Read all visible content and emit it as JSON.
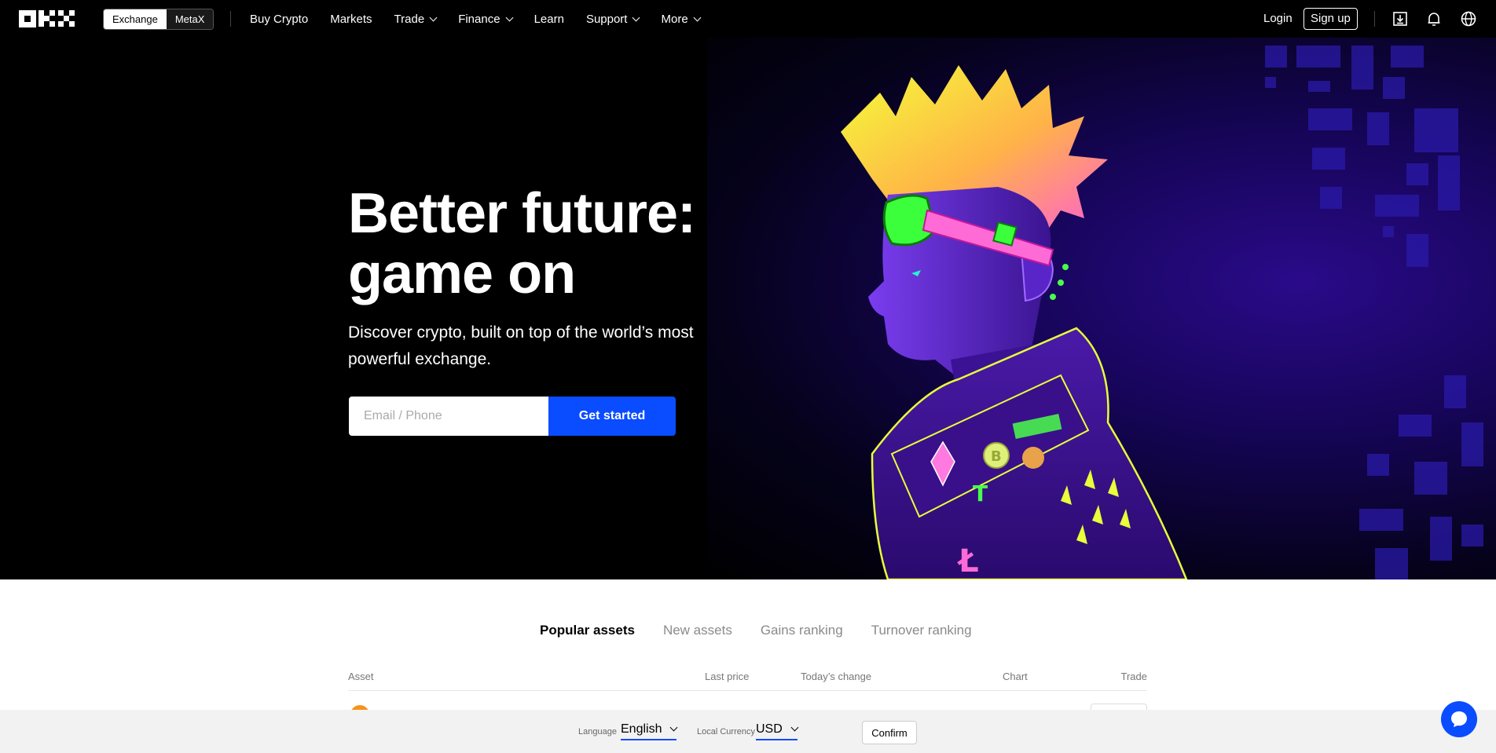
{
  "nav": {
    "switcher": [
      "Exchange",
      "MetaX"
    ],
    "links": [
      {
        "label": "Buy Crypto",
        "dropdown": false
      },
      {
        "label": "Markets",
        "dropdown": false
      },
      {
        "label": "Trade",
        "dropdown": true
      },
      {
        "label": "Finance",
        "dropdown": true
      },
      {
        "label": "Learn",
        "dropdown": false
      },
      {
        "label": "Support",
        "dropdown": true
      },
      {
        "label": "More",
        "dropdown": true
      }
    ],
    "login": "Login",
    "signup": "Sign up",
    "icons": [
      "download-icon",
      "bell-icon",
      "globe-icon"
    ]
  },
  "hero": {
    "headline_line1": "Better future:",
    "headline_line2": "game on",
    "subtitle": "Discover crypto, built on top of the world’s most powerful exchange.",
    "email_placeholder": "Email / Phone",
    "cta": "Get started",
    "accent_color": "#0a4cff"
  },
  "markets": {
    "tabs": [
      "Popular assets",
      "New assets",
      "Gains ranking",
      "Turnover ranking"
    ],
    "active_tab": "Popular assets",
    "columns": [
      "Asset",
      "Last price",
      "Today’s change",
      "Chart",
      "Trade"
    ]
  },
  "footer_bar": {
    "language_label": "Language",
    "language_value": "English",
    "currency_label": "Local Currency",
    "currency_value": "USD",
    "confirm": "Confirm"
  }
}
